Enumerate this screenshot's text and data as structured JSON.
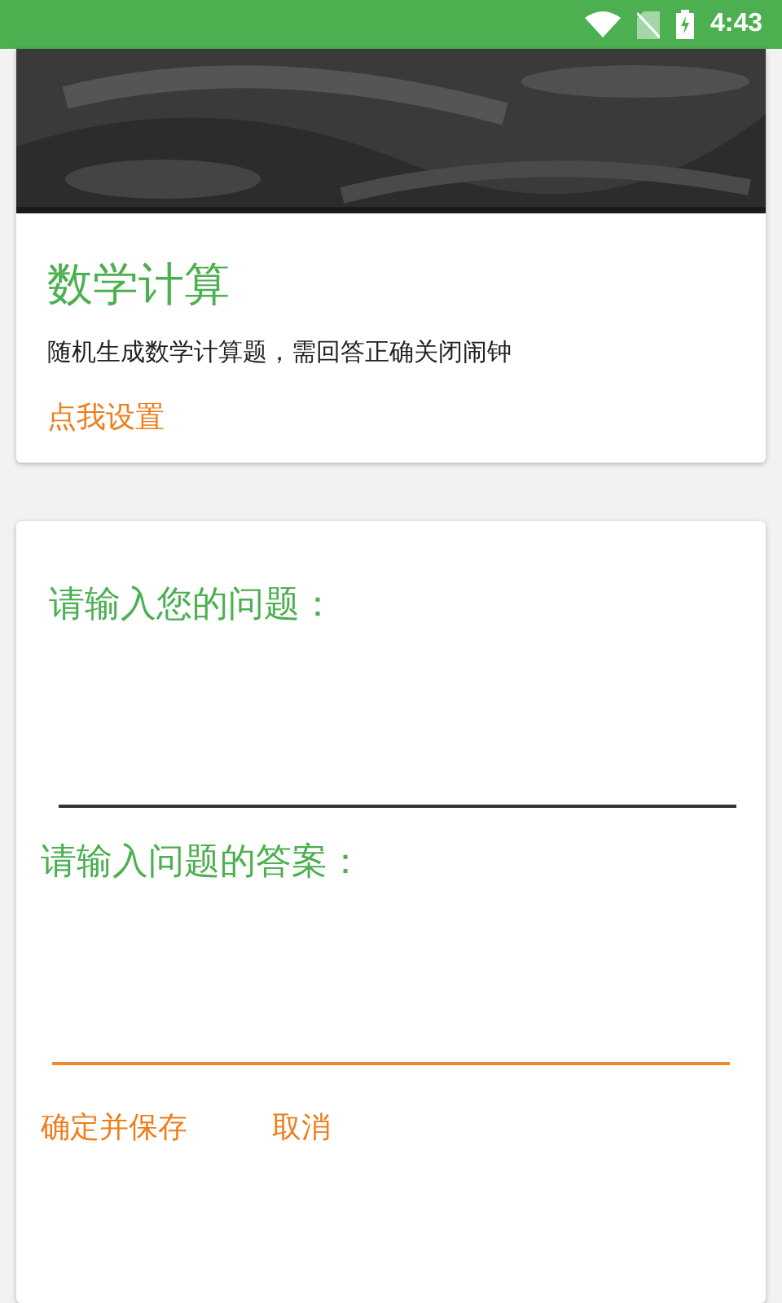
{
  "status_bar": {
    "time": "4:43"
  },
  "feature_card": {
    "title": "数学计算",
    "description": "随机生成数学计算题，需回答正确关闭闹钟",
    "settings_link": "点我设置"
  },
  "question_form": {
    "fields": [
      {
        "label": "请输入您的问题：",
        "focused": false
      },
      {
        "label": "请输入问题的答案：",
        "focused": true
      }
    ],
    "buttons": [
      "确定并保存",
      "取消"
    ]
  }
}
